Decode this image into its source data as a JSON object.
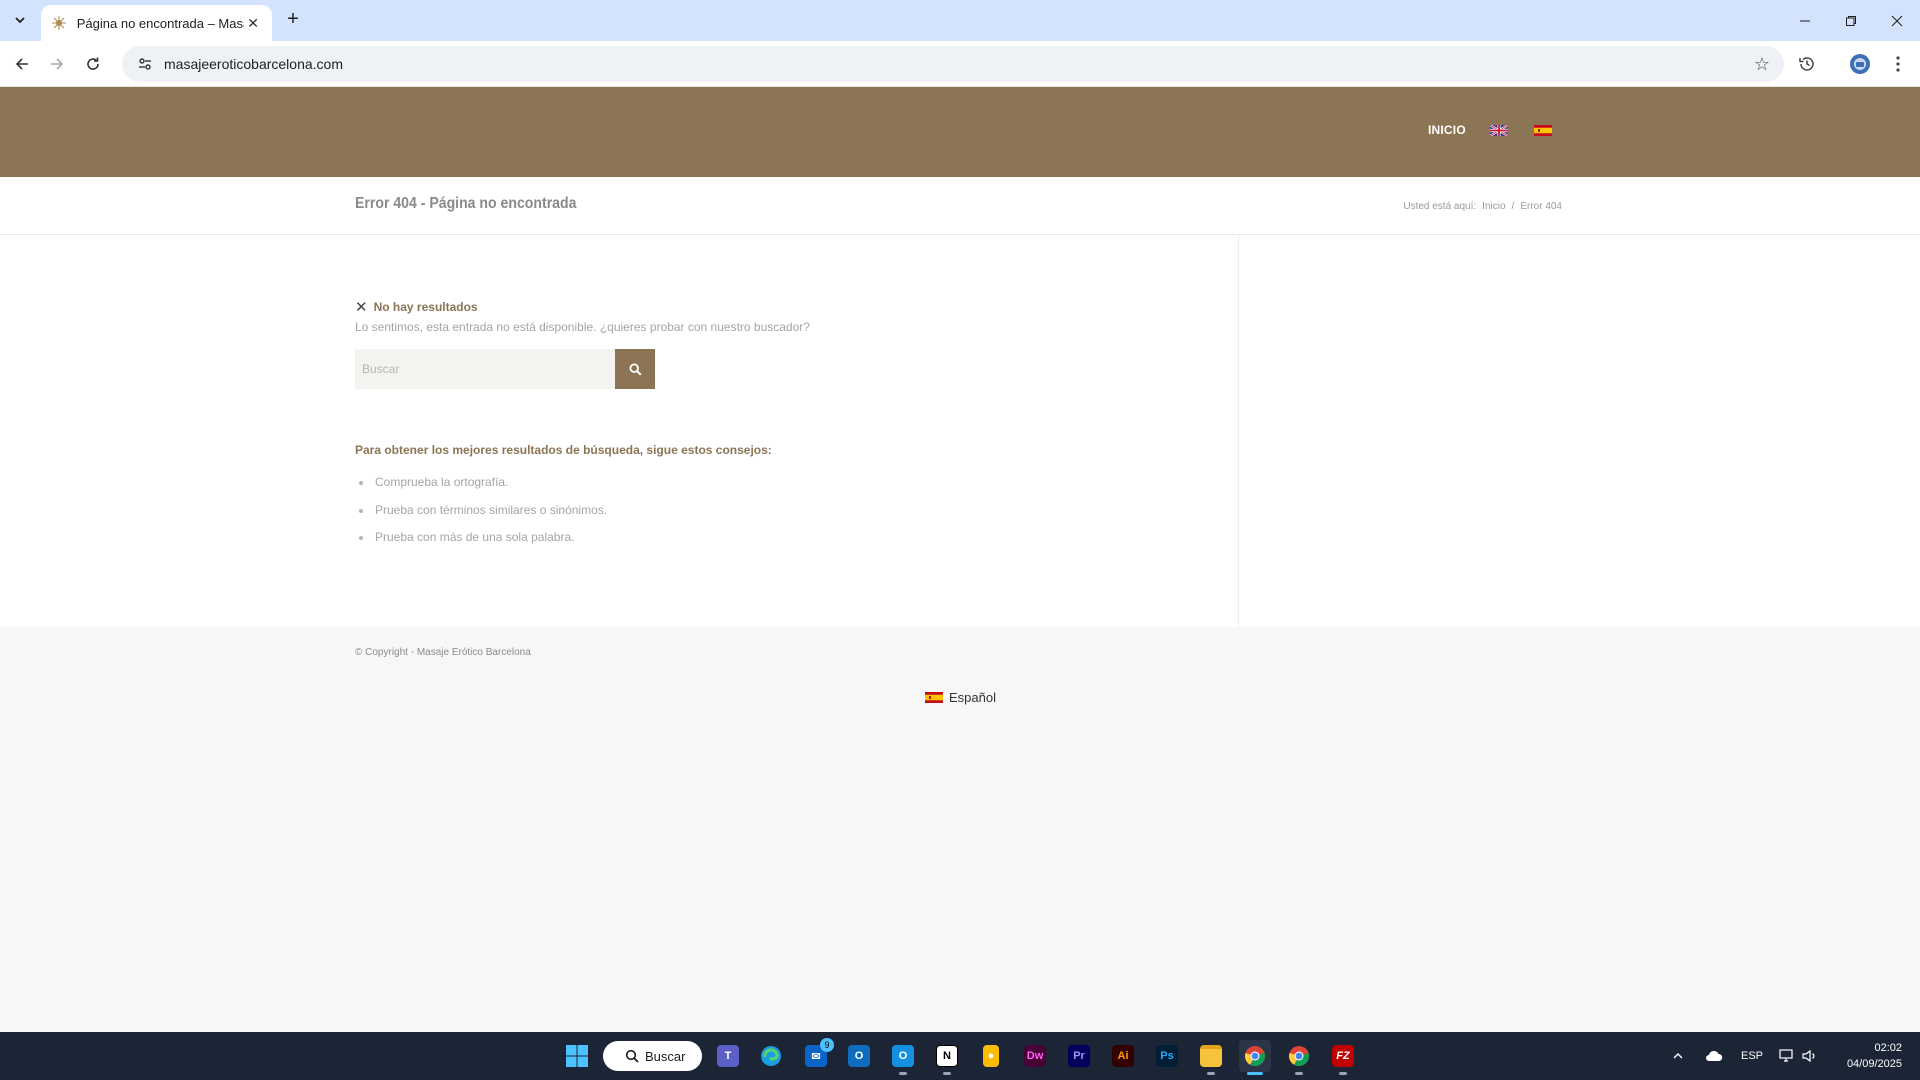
{
  "browser": {
    "tab_title": "Página no encontrada – Masaje Erótico Barcelona",
    "url": "masajeeroticobarcelona.com",
    "new_tab_symbol": "+",
    "close_symbol": "✕"
  },
  "site": {
    "brand_color": "#8c7554",
    "nav": {
      "home": "INICIO"
    },
    "page_title": "Error 404 - Página no encontrada",
    "breadcrumb": {
      "prefix": "Usted está aquí:",
      "home": "Inicio",
      "separator": "/",
      "current": "Error 404"
    },
    "no_results": {
      "title": "No hay resultados",
      "message": "Lo sentimos, esta entrada no está disponible. ¿quieres probar con nuestro buscador?"
    },
    "search": {
      "placeholder": "Buscar"
    },
    "tips": {
      "title": "Para obtener los mejores resultados de búsqueda, sigue estos consejos:",
      "items": [
        "Comprueba la ortografía.",
        "Prueba con términos similares o sinónimos.",
        "Prueba con más de una sola palabra."
      ]
    },
    "footer": {
      "copyright": "© Copyright - Masaje Erótico Barcelona",
      "language": "Español"
    }
  },
  "taskbar": {
    "search_label": "Buscar",
    "language": "ESP",
    "time": "02:02",
    "date": "04/09/2025",
    "mail_badge": "9",
    "apps": [
      "start",
      "teams",
      "edge",
      "mail",
      "outlook",
      "notion",
      "keep",
      "dreamweaver",
      "premiere",
      "illustrator",
      "photoshop",
      "explorer",
      "chrome",
      "chrome-profile",
      "filezilla"
    ]
  }
}
